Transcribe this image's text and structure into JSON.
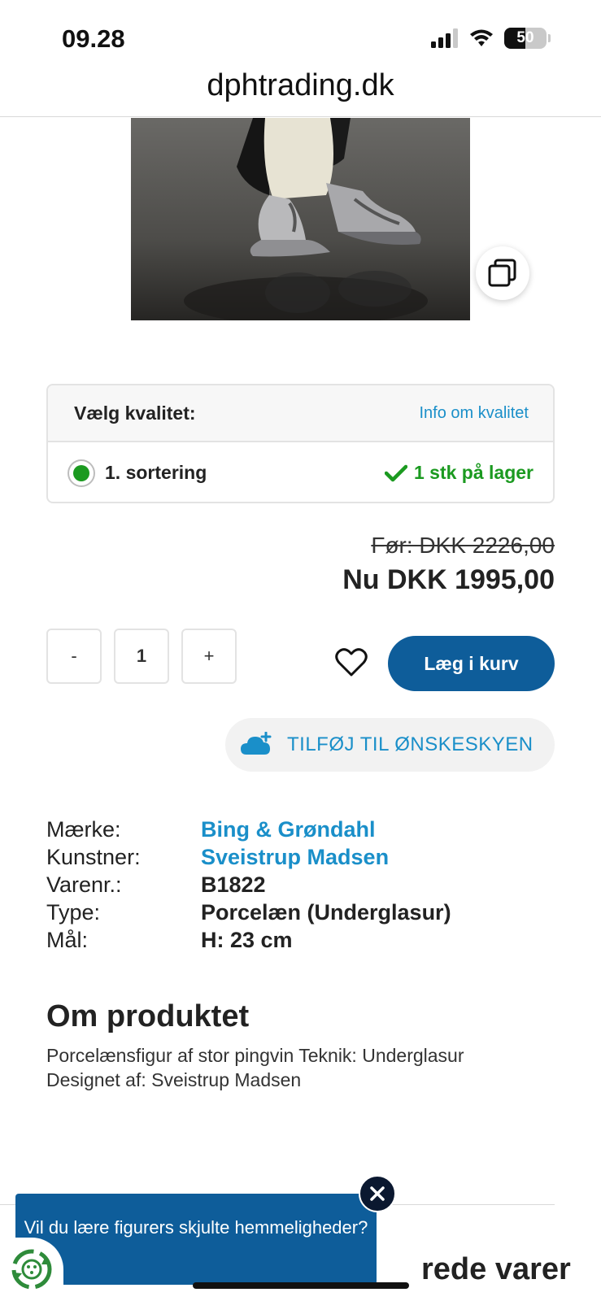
{
  "status_bar": {
    "time": "09.28",
    "battery_level": "50",
    "battery_fraction": 0.5
  },
  "browser": {
    "url": "dphtrading.dk"
  },
  "product": {
    "quality": {
      "title": "Vælg kvalitet:",
      "info_link": "Info om kvalitet",
      "option_label": "1. sortering",
      "stock_text": "1 stk på lager"
    },
    "price_before": "Før: DKK 2226,00",
    "price_now": "Nu DKK 1995,00",
    "quantity": {
      "minus_label": "-",
      "value": "1",
      "plus_label": "+"
    },
    "add_to_cart": "Læg i kurv",
    "wishlist_button": "TILFØJ TIL ØNSKESKYEN",
    "specs": [
      {
        "key": "Mærke:",
        "value": "Bing & Grøndahl",
        "link": true
      },
      {
        "key": "Kunstner:",
        "value": "Sveistrup Madsen",
        "link": true
      },
      {
        "key": "Varenr.:",
        "value": "B1822",
        "link": false
      },
      {
        "key": "Type:",
        "value": "Porcelæn (Underglasur)",
        "link": false
      },
      {
        "key": "Mål:",
        "value": "H: 23 cm",
        "link": false
      }
    ],
    "about_title": "Om produktet",
    "about_text": "Porcelænsfigur af stor pingvin Teknik: Underglasur Designet af: Sveistrup Madsen"
  },
  "bottom": {
    "heading_partial": "rede varer"
  },
  "popup": {
    "text": "Vil du lære figurers skjulte hemmeligheder?"
  },
  "colors": {
    "accent_blue": "#0e5d9a",
    "link_blue": "#1a8fc9",
    "stock_green": "#1b9a20"
  }
}
